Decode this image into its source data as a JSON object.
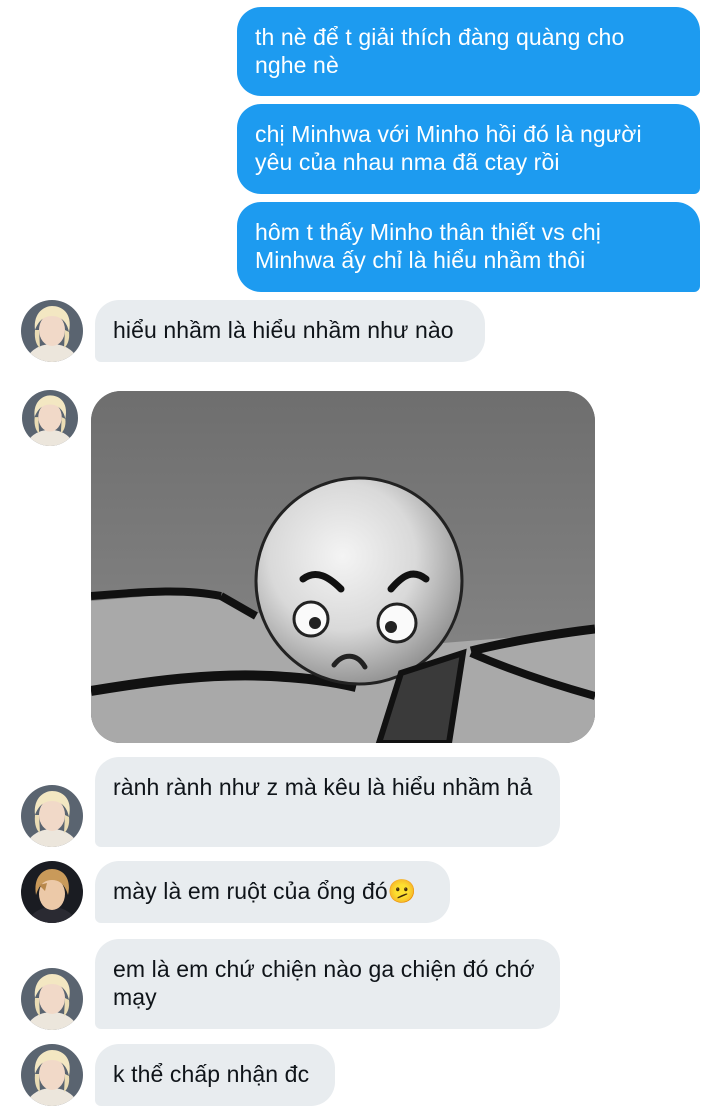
{
  "messages": {
    "m1": "th nè để t giải thích đàng quàng cho nghe nè",
    "m2": "chị Minhwa với Minho hồi đó là người yêu của nhau nma đã ctay rồi",
    "m3": "hôm t thấy Minho thân thiết vs chị Minhwa ấy chỉ là hiểu nhầm thôi",
    "m4": "hiểu nhầm là hiểu nhầm như nào",
    "m6": "rành rành như z mà kêu là hiểu nhầm hả",
    "m7": "mày là em ruột của ổng đó🫤",
    "m8": "em là em chứ chiện nào ga chiện đó chớ mạy",
    "m9": "k thể chấp nhận đc"
  },
  "colors": {
    "sent_bubble": "#1d9bf0",
    "received_bubble": "#e8ecef",
    "text_dark": "#0f1419"
  },
  "icons": {
    "avatar_a": "avatar-blonde",
    "avatar_b": "avatar-dark",
    "media": "angry-ball-meme-image"
  }
}
